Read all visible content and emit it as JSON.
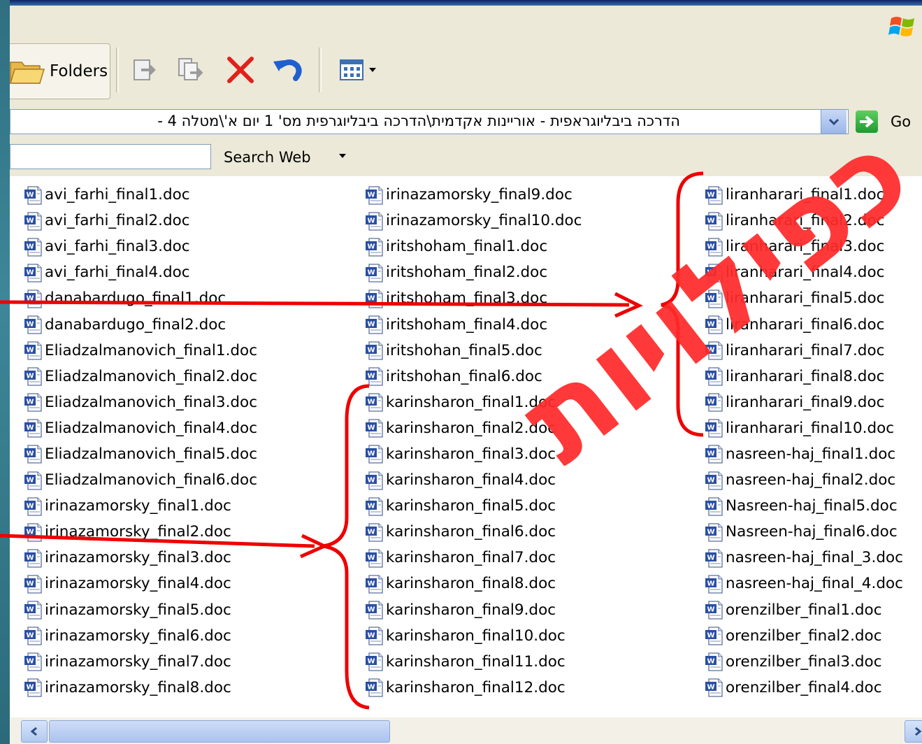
{
  "toolbar": {
    "folders_label": "Folders"
  },
  "address": {
    "path": "הדרכה ביבליוגראפית - אוריינות אקדמית\\הדרכה ביבליוגרפית מס' 1 יום א'\\מטלה 4 -",
    "go_label": "Go"
  },
  "search": {
    "web_label": "Search Web"
  },
  "columns": [
    {
      "files": [
        "avi_farhi_final1.doc",
        "avi_farhi_final2.doc",
        "avi_farhi_final3.doc",
        "avi_farhi_final4.doc",
        "danabardugo_final1.doc",
        "danabardugo_final2.doc",
        "Eliadzalmanovich_final1.doc",
        "Eliadzalmanovich_final2.doc",
        "Eliadzalmanovich_final3.doc",
        "Eliadzalmanovich_final4.doc",
        "Eliadzalmanovich_final5.doc",
        "Eliadzalmanovich_final6.doc",
        "irinazamorsky_final1.doc",
        "irinazamorsky_final2.doc",
        "irinazamorsky_final3.doc",
        "irinazamorsky_final4.doc",
        "irinazamorsky_final5.doc",
        "irinazamorsky_final6.doc",
        "irinazamorsky_final7.doc",
        "irinazamorsky_final8.doc"
      ]
    },
    {
      "files": [
        "irinazamorsky_final9.doc",
        "irinazamorsky_final10.doc",
        "iritshoham_final1.doc",
        "iritshoham_final2.doc",
        "iritshoham_final3.doc",
        "iritshoham_final4.doc",
        "iritshohan_final5.doc",
        "iritshohan_final6.doc",
        "karinsharon_final1.doc",
        "karinsharon_final2.doc",
        "karinsharon_final3.doc",
        "karinsharon_final4.doc",
        "karinsharon_final5.doc",
        "karinsharon_final6.doc",
        "karinsharon_final7.doc",
        "karinsharon_final8.doc",
        "karinsharon_final9.doc",
        "karinsharon_final10.doc",
        "karinsharon_final11.doc",
        "karinsharon_final12.doc"
      ]
    },
    {
      "files": [
        "liranharari_final1.doc",
        "liranharari_final2.doc",
        "liranharari_final3.doc",
        "liranharari_final4.doc",
        "liranharari_final5.doc",
        "liranharari_final6.doc",
        "liranharari_final7.doc",
        "liranharari_final8.doc",
        "liranharari_final9.doc",
        "liranharari_final10.doc",
        "nasreen-haj_final1.doc",
        "nasreen-haj_final2.doc",
        "Nasreen-haj_final5.doc",
        "Nasreen-haj_final6.doc",
        "nasreen-haj_final_3.doc",
        "nasreen-haj_final_4.doc",
        "orenzilber_final1.doc",
        "orenzilber_final2.doc",
        "orenzilber_final3.doc",
        "orenzilber_final4.doc"
      ]
    }
  ],
  "overlay": {
    "stamp_text": "כפילויות",
    "stamp_color": "#ff2a2a",
    "annotation_color": "#ee0000"
  }
}
